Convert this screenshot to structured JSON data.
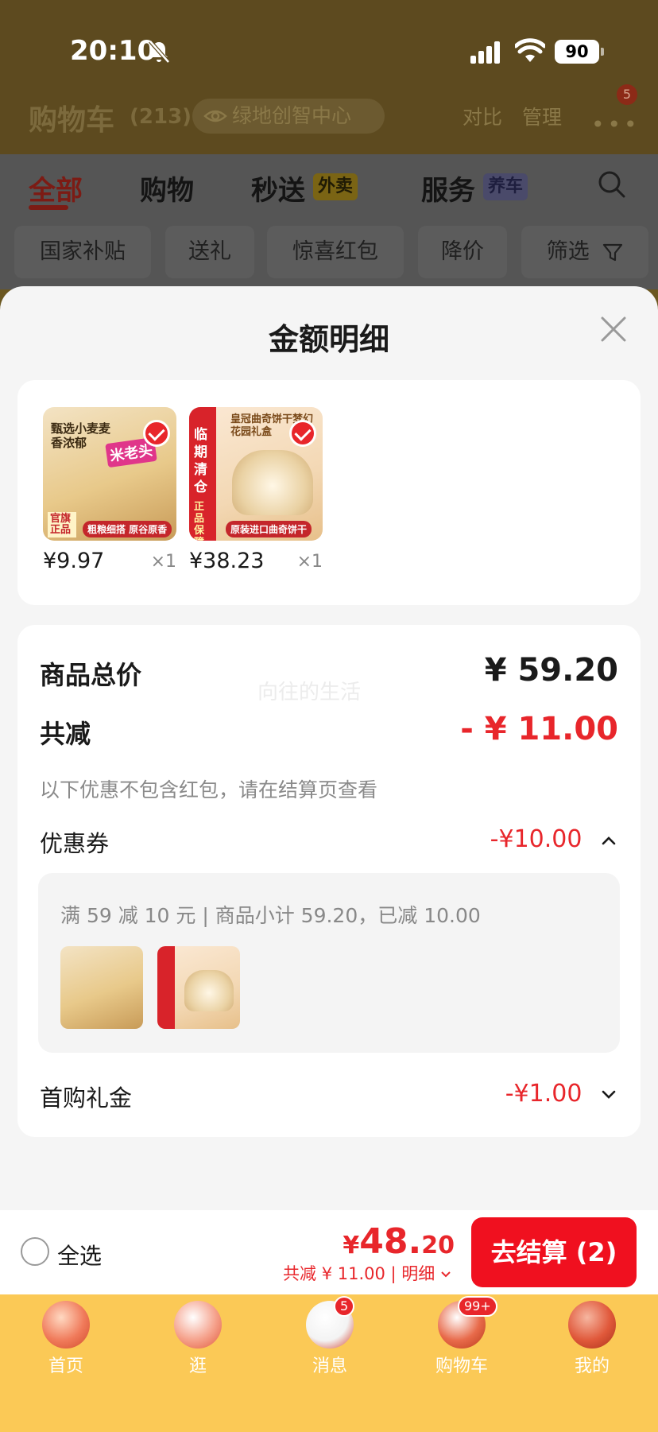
{
  "status_bar": {
    "time": "20:10",
    "battery": "90"
  },
  "header": {
    "title": "购物车",
    "count": "(213)",
    "location": "绿地创智中心",
    "compare": "对比",
    "manage": "管理",
    "more_badge": "5"
  },
  "tabs": [
    {
      "label": "全部"
    },
    {
      "label": "购物"
    },
    {
      "label": "秒送",
      "badge": "外卖"
    },
    {
      "label": "服务",
      "badge": "养车"
    }
  ],
  "chips": [
    "国家补贴",
    "送礼",
    "惊喜红包",
    "降价",
    "筛选"
  ],
  "sheet": {
    "title": "金额明细",
    "products": [
      {
        "price": "¥9.97",
        "qty": "×1",
        "img_text": {
          "name": "甄选小麦麦香浓郁",
          "brand": "米老头",
          "foot": "粗粮细搭 原谷原香",
          "corner": "官旗正品"
        }
      },
      {
        "price": "¥38.23",
        "qty": "×1",
        "img_text": {
          "side": "临期清仓",
          "side2": "正品保障",
          "title": "皇冠曲奇饼干梦幻花园礼盒",
          "foot": "原装进口曲奇饼干"
        }
      }
    ],
    "total_label": "商品总价",
    "total_value": "¥ 59.20",
    "watermark": "向往的生活",
    "discount_label": "共减",
    "discount_value": "- ¥ 11.00",
    "note": "以下优惠不包含红包，请在结算页查看",
    "coupon_label": "优惠券",
    "coupon_value": "-¥10.00",
    "coupon_detail": "满 59 减 10 元 | 商品小计 59.20，已减 10.00",
    "gift_label": "首购礼金",
    "gift_value": "-¥1.00"
  },
  "checkout": {
    "select_all": "全选",
    "total_symbol": "¥",
    "total_int": "48.",
    "total_dec": "20",
    "total_note": "共减 ¥ 11.00 | 明细",
    "button": "去结算 (2)"
  },
  "nav": [
    {
      "label": "首页"
    },
    {
      "label": "逛"
    },
    {
      "label": "消息",
      "badge": "5"
    },
    {
      "label": "购物车",
      "badge": "99+"
    },
    {
      "label": "我的"
    }
  ],
  "colors": {
    "accent_red": "#e8262b",
    "checkout_red": "#f0101f",
    "nav_yellow": "#fbc956"
  }
}
